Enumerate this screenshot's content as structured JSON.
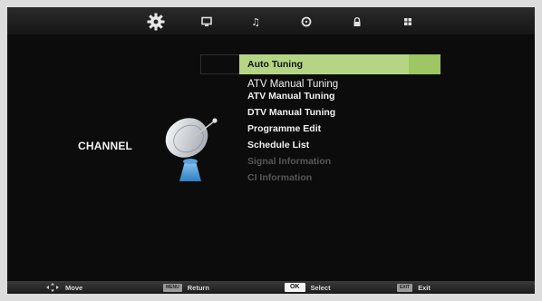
{
  "category_label": "CHANNEL",
  "tabs": [
    {
      "icon": "gear-icon",
      "active": true
    },
    {
      "icon": "picture-icon"
    },
    {
      "icon": "music-note-icon"
    },
    {
      "icon": "clock-icon"
    },
    {
      "icon": "lock-icon"
    },
    {
      "icon": "grid-icon"
    }
  ],
  "menu": {
    "items": [
      {
        "label": "Auto Tuning",
        "state": "selected"
      },
      {
        "label": "ATV Manual Tuning",
        "state": "normal"
      },
      {
        "label": "ATV Manual Tuning",
        "state": "normal"
      },
      {
        "label": "DTV Manual Tuning",
        "state": "normal"
      },
      {
        "label": "Programme Edit",
        "state": "normal"
      },
      {
        "label": "Schedule List",
        "state": "normal"
      },
      {
        "label": "Signal Information",
        "state": "disabled"
      },
      {
        "label": "CI Information",
        "state": "disabled"
      }
    ]
  },
  "hints": {
    "move": "Move",
    "return_key": "MENU",
    "return": "Return",
    "select_key": "OK",
    "select": "Select",
    "exit_key": "EXIT",
    "exit": "Exit"
  },
  "colors": {
    "selection": "#b6d584",
    "selection_ext": "#9ec663",
    "background": "#0c0c0c"
  }
}
